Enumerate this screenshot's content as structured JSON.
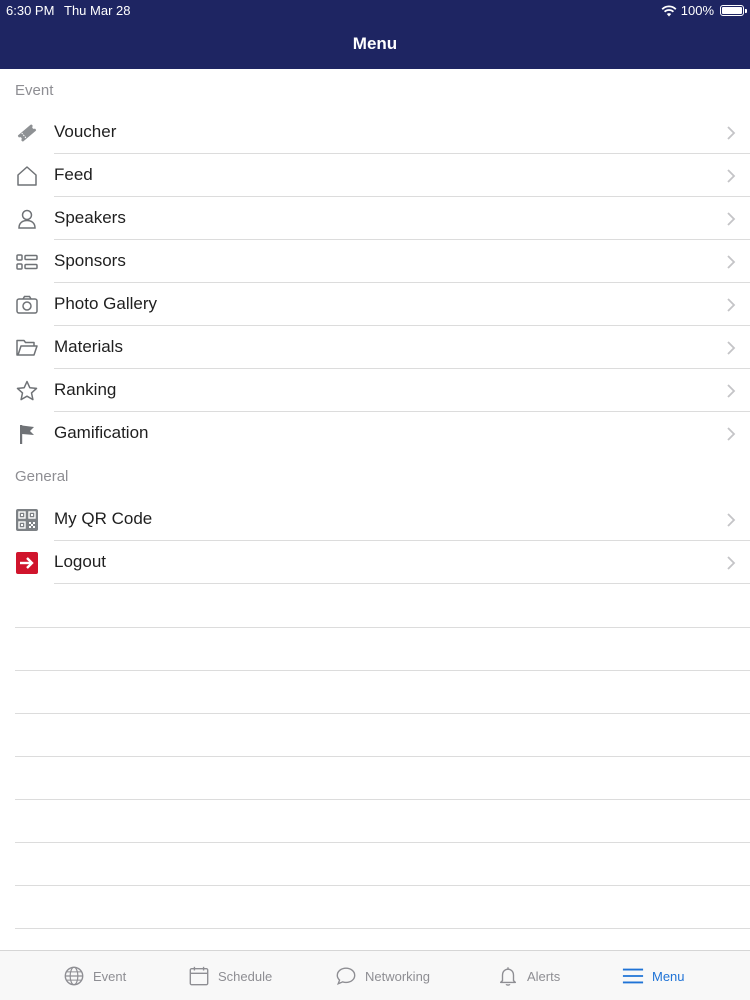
{
  "status_bar": {
    "time": "6:30 PM",
    "date": "Thu Mar 28",
    "battery": "100%"
  },
  "header": {
    "title": "Menu"
  },
  "sections": {
    "event": "Event",
    "general": "General"
  },
  "menu": {
    "voucher": "Voucher",
    "feed": "Feed",
    "speakers": "Speakers",
    "sponsors": "Sponsors",
    "photo_gallery": "Photo Gallery",
    "materials": "Materials",
    "ranking": "Ranking",
    "gamification": "Gamification",
    "qr_code": "My QR Code",
    "logout": "Logout"
  },
  "tabs": {
    "event": "Event",
    "schedule": "Schedule",
    "networking": "Networking",
    "alerts": "Alerts",
    "menu": "Menu"
  },
  "colors": {
    "header_bg": "#1e2562",
    "active_tab": "#1f73d6",
    "logout_icon": "#d0142c"
  }
}
